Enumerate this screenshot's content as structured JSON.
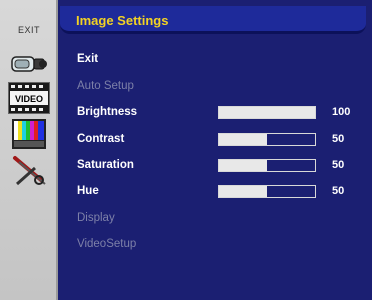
{
  "sidebar": {
    "exit_label": "EXIT",
    "icons": [
      "camera-icon",
      "video-icon",
      "color-bars-icon",
      "tools-icon"
    ],
    "video_badge": "VIDEO"
  },
  "header": {
    "title": "Image Settings",
    "title_color": "#f2d224"
  },
  "menu": {
    "exit": "Exit",
    "auto_setup": "Auto Setup",
    "brightness": "Brightness",
    "contrast": "Contrast",
    "saturation": "Saturation",
    "hue": "Hue",
    "display": "Display",
    "video_setup": "VideoSetup"
  },
  "settings": {
    "brightness": {
      "value": "100",
      "level": 1.0
    },
    "contrast": {
      "value": "50",
      "level": 0.5
    },
    "saturation": {
      "value": "50",
      "level": 0.5
    },
    "hue": {
      "value": "50",
      "level": 0.5
    }
  },
  "colors": {
    "background": "#1b1f72",
    "accent": "#f2d224",
    "inactive_text": "#7d80a8"
  }
}
